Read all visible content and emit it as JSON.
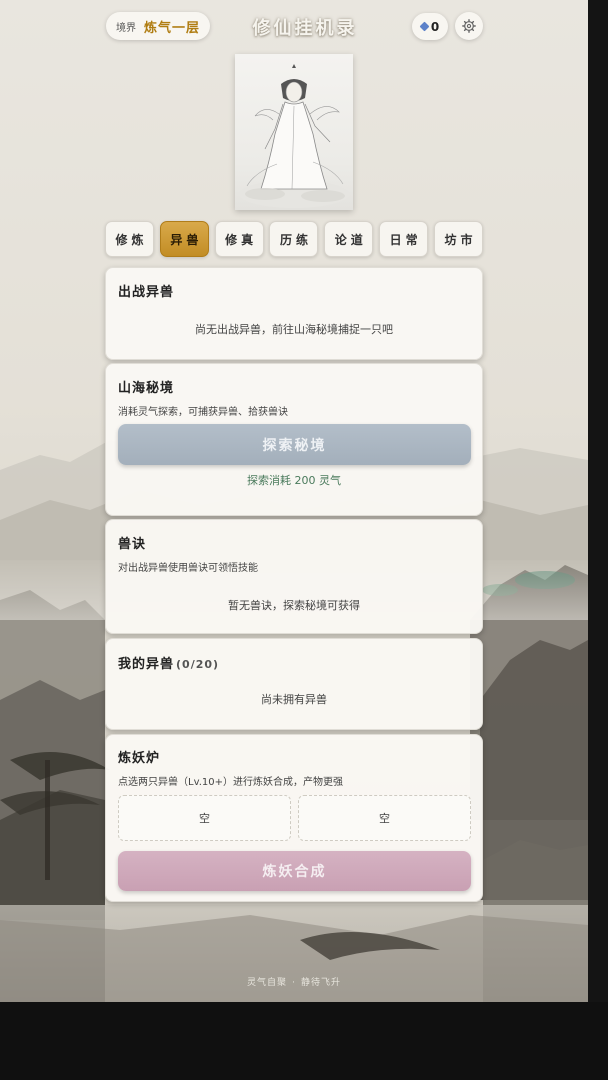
{
  "header": {
    "realm_label": "境界",
    "realm_value": "炼气一层",
    "title": "修仙挂机录",
    "gems": "0",
    "gem_icon": "diamond-icon",
    "settings_icon": "gear-icon"
  },
  "tabs": [
    {
      "label": "修炼",
      "active": false
    },
    {
      "label": "异兽",
      "active": true
    },
    {
      "label": "修真",
      "active": false
    },
    {
      "label": "历练",
      "active": false
    },
    {
      "label": "论道",
      "active": false
    },
    {
      "label": "日常",
      "active": false
    },
    {
      "label": "坊市",
      "active": false
    }
  ],
  "active_beast": {
    "title": "出战异兽",
    "empty": "尚无出战异兽，前往山海秘境捕捉一只吧"
  },
  "secret_realm": {
    "title": "山海秘境",
    "desc": "消耗灵气探索，可捕获异兽、拾获兽诀",
    "button": "探索秘境",
    "cost": "探索消耗 200 灵气"
  },
  "beast_arts": {
    "title": "兽诀",
    "desc": "对出战异兽使用兽诀可领悟技能",
    "empty": "暂无兽诀，探索秘境可获得"
  },
  "my_beasts": {
    "title": "我的异兽",
    "count": "(0/20)",
    "empty": "尚未拥有异兽"
  },
  "furnace": {
    "title": "炼妖炉",
    "desc": "点选两只异兽（Lv.10+）进行炼妖合成，产物更强",
    "slot_left": "空",
    "slot_right": "空",
    "button": "炼妖合成"
  },
  "footer": {
    "left": "灵气自聚",
    "right": "静待飞升"
  },
  "colors": {
    "gold_accent": "#c28d25",
    "explore_button": "#a9b5c1",
    "fuse_button": "#cda6b8",
    "cost_text": "#4a7a5c"
  }
}
